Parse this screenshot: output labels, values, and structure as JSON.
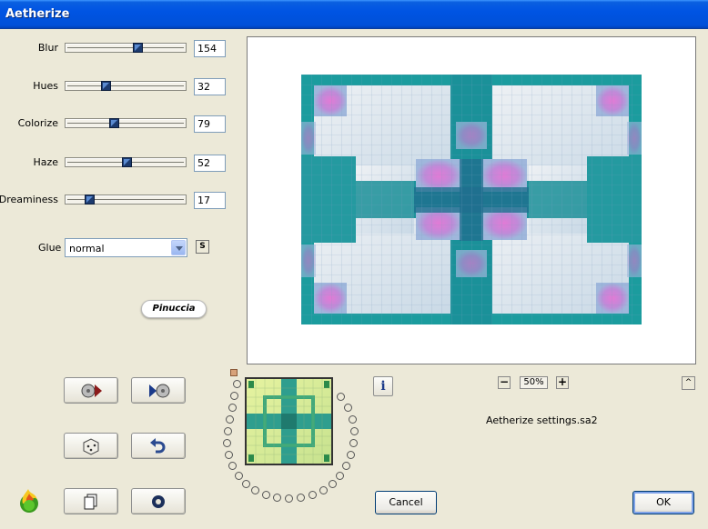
{
  "window": {
    "title": "Aetherize"
  },
  "sliders": [
    {
      "label": "Blur",
      "value": "154",
      "position": 0.6
    },
    {
      "label": "Hues",
      "value": "32",
      "position": 0.33
    },
    {
      "label": "Colorize",
      "value": "79",
      "position": 0.4
    },
    {
      "label": "Haze",
      "value": "52",
      "position": 0.51
    },
    {
      "label": "Dreaminess",
      "value": "17",
      "position": 0.2
    }
  ],
  "glue": {
    "label": "Glue",
    "value": "normal",
    "side_button": "S"
  },
  "logo": {
    "text": "Pinuccia"
  },
  "zoom": {
    "value": "50%",
    "minus": "−",
    "plus": "+"
  },
  "settings_file": "Aetherize settings.sa2",
  "buttons": {
    "cancel": "Cancel",
    "ok": "OK",
    "info": "i",
    "up": "^"
  },
  "colors": {
    "titlebar": "#0054e3",
    "dialog_bg": "#ece9d8",
    "preview_teal": "#1a9a9a",
    "preview_pink": "#d979c9"
  }
}
